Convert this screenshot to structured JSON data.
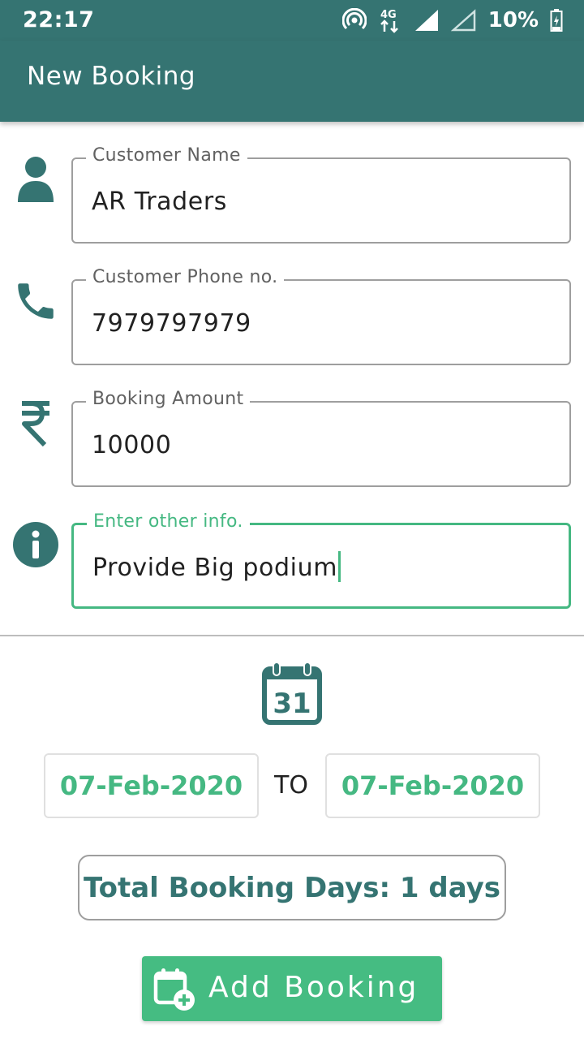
{
  "status_bar": {
    "time": "22:17",
    "battery": "10%",
    "icons": [
      "hotspot-icon",
      "4g-data-icon",
      "signal-full-icon",
      "signal-empty-icon",
      "battery-icon"
    ]
  },
  "app_bar": {
    "title": "New Booking"
  },
  "form": {
    "customer_name": {
      "label": "Customer Name",
      "value": "AR Traders",
      "icon": "person-icon"
    },
    "customer_phone": {
      "label": "Customer Phone no.",
      "value": "7979797979",
      "icon": "phone-icon"
    },
    "booking_amount": {
      "label": "Booking Amount",
      "value": "10000",
      "icon": "rupee-icon"
    },
    "other_info": {
      "label": "Enter other info.",
      "value": "Provide Big podium",
      "icon": "info-icon",
      "focused": true
    }
  },
  "dates": {
    "calendar_day": "31",
    "from": "07-Feb-2020",
    "separator": "TO",
    "to": "07-Feb-2020"
  },
  "total": {
    "text": "Total Booking Days: 1 days"
  },
  "add_button": {
    "label": "Add Booking",
    "icon": "calendar-add-icon"
  },
  "colors": {
    "primary": "#357472",
    "accent": "#45b882",
    "button": "#45bc82"
  }
}
